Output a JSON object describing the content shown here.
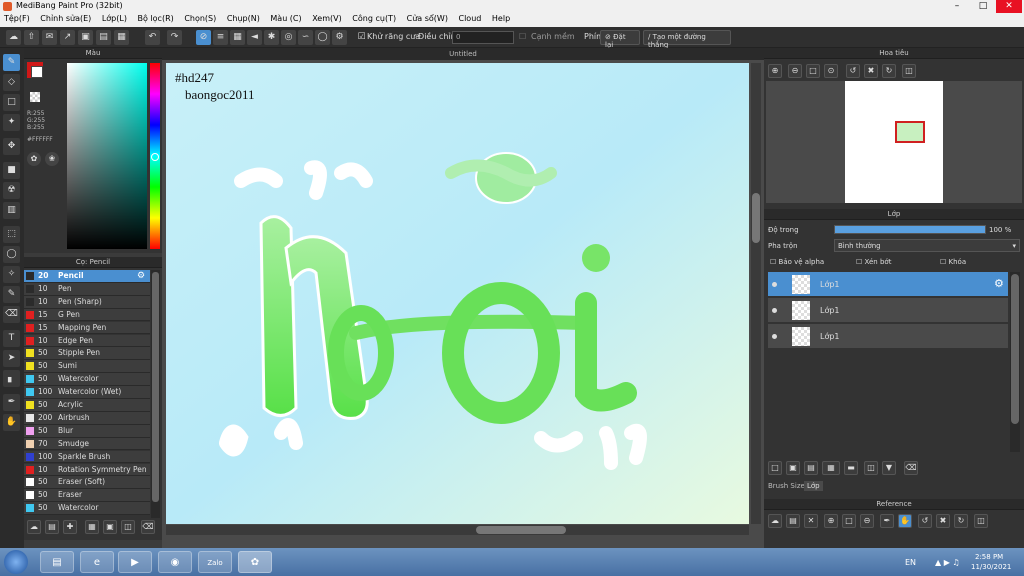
{
  "window": {
    "title": "MediBang Paint Pro (32bit)"
  },
  "menu": [
    "Tệp(F)",
    "Chỉnh sửa(E)",
    "Lớp(L)",
    "Bộ lọc(R)",
    "Chọn(S)",
    "Chụp(N)",
    "Màu (C)",
    "Xem(V)",
    "Công cụ(T)",
    "Cửa sổ(W)",
    "Cloud",
    "Help"
  ],
  "toolbar": {
    "antialias": "Khử răng cưa",
    "adjust_label": "Điều chỉnh",
    "adjust_value": "0",
    "edge_label": "Cạnh mềm",
    "key_label": "Phím",
    "reset_label": "Đặt lại",
    "ruler_label": "Tạo một đường thẳng"
  },
  "color_panel": {
    "title": "Màu",
    "r": "R:255",
    "g": "G:255",
    "b": "B:255",
    "hex": "#FFFFFF",
    "primary": "#ffffff",
    "secondary": "#d01818"
  },
  "brush_panel": {
    "title": "Cọ: Pencil",
    "items": [
      {
        "size": "20",
        "name": "Pencil",
        "color": "#2b2b2b"
      },
      {
        "size": "10",
        "name": "Pen",
        "color": "#2b2b2b"
      },
      {
        "size": "10",
        "name": "Pen (Sharp)",
        "color": "#2b2b2b"
      },
      {
        "size": "15",
        "name": "G Pen",
        "color": "#e02020"
      },
      {
        "size": "15",
        "name": "Mapping Pen",
        "color": "#e02020"
      },
      {
        "size": "10",
        "name": "Edge Pen",
        "color": "#e02020"
      },
      {
        "size": "50",
        "name": "Stipple Pen",
        "color": "#f0e020"
      },
      {
        "size": "50",
        "name": "Sumi",
        "color": "#f0e020"
      },
      {
        "size": "50",
        "name": "Watercolor",
        "color": "#40c8f0"
      },
      {
        "size": "100",
        "name": "Watercolor (Wet)",
        "color": "#40c8f0"
      },
      {
        "size": "50",
        "name": "Acrylic",
        "color": "#f0e020"
      },
      {
        "size": "200",
        "name": "Airbrush",
        "color": "#e8e8e8"
      },
      {
        "size": "50",
        "name": "Blur",
        "color": "#f0a0f0"
      },
      {
        "size": "70",
        "name": "Smudge",
        "color": "#f0d0b0"
      },
      {
        "size": "100",
        "name": "Sparkle Brush",
        "color": "#3040d0"
      },
      {
        "size": "10",
        "name": "Rotation Symmetry Pen",
        "color": "#e02020"
      },
      {
        "size": "50",
        "name": "Eraser (Soft)",
        "color": "#ffffff"
      },
      {
        "size": "50",
        "name": "Eraser",
        "color": "#ffffff"
      },
      {
        "size": "50",
        "name": "Watercolor",
        "color": "#40c8f0"
      }
    ]
  },
  "canvas": {
    "tab": "Untitled",
    "line1": "#hd247",
    "line2": "baongoc2011",
    "art_letters": "Nỗi"
  },
  "navigator": {
    "title": "Hoa tiêu"
  },
  "layer_panel": {
    "title": "Lớp",
    "opacity_label": "Độ trong",
    "opacity_value": "100 %",
    "opacity_fraction": 1.0,
    "blend_label": "Pha trộn",
    "blend_value": "Bình thường",
    "protect_alpha": "Bảo vệ alpha",
    "clipping": "Xén bớt",
    "lock": "Khóa",
    "layers": [
      "Lớp1",
      "Lớp1",
      "Lớp1"
    ],
    "tab_brush_size": "Brush Size",
    "tab_layer": "Lớp"
  },
  "reference": {
    "title": "Reference"
  },
  "taskbar": {
    "lang": "EN",
    "time": "2:58 PM",
    "date": "11/30/2021",
    "zalo": "Zalo"
  }
}
